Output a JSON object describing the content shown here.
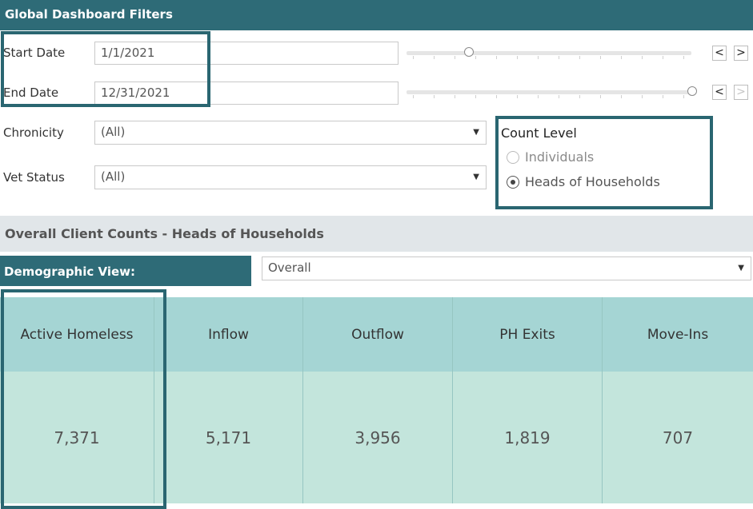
{
  "header": {
    "title": "Global Dashboard Filters"
  },
  "filters": {
    "start_date": {
      "label": "Start Date",
      "value": "1/1/2021"
    },
    "end_date": {
      "label": "End Date",
      "value": "12/31/2021"
    },
    "chronicity": {
      "label": "Chronicity",
      "value": "(All)"
    },
    "vet_status": {
      "label": "Vet Status",
      "value": "(All)"
    },
    "date_nav": {
      "prev": "<",
      "next": ">"
    }
  },
  "count_level": {
    "title": "Count Level",
    "options": [
      {
        "label": "Individuals",
        "selected": false
      },
      {
        "label": "Heads of Households",
        "selected": true
      }
    ]
  },
  "section": {
    "title": "Overall Client Counts - Heads of Households"
  },
  "demographic": {
    "label": "Demographic View:",
    "value": "Overall"
  },
  "metrics": [
    {
      "label": "Active Homeless",
      "value": "7,371"
    },
    {
      "label": "Inflow",
      "value": "5,171"
    },
    {
      "label": "Outflow",
      "value": "3,956"
    },
    {
      "label": "PH Exits",
      "value": "1,819"
    },
    {
      "label": "Move-Ins",
      "value": "707"
    }
  ],
  "colors": {
    "header": "#2e6b77",
    "highlight_border": "#2a6671",
    "metric_header": "#a5d5d4",
    "metric_value": "#c3e5dc",
    "band": "#e1e6e9"
  },
  "icons": {
    "slider_thumb": "circle",
    "select_caret": "triangle-down",
    "prev": "chevron-left",
    "next": "chevron-right"
  }
}
